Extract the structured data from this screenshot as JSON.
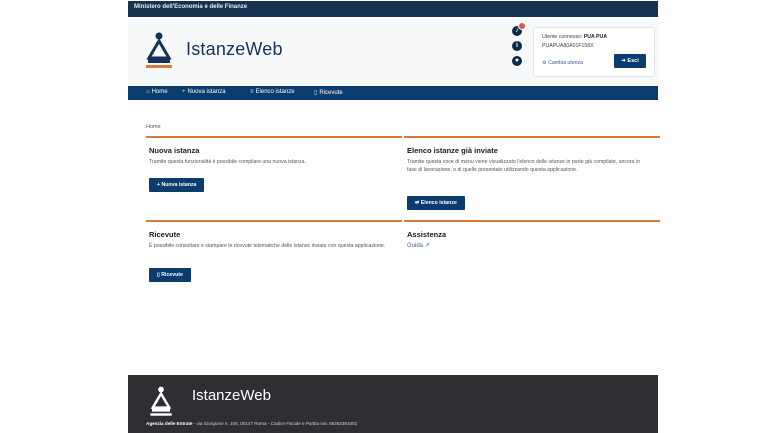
{
  "topbar": {
    "org": "Ministero dell'Economia e delle Finanze"
  },
  "header": {
    "app_title": "IstanzeWeb",
    "icons": [
      "bell-icon",
      "info-icon",
      "user-icon"
    ],
    "user": {
      "line1_label": "Utente connesso:",
      "line1_value": "PUA PUA",
      "line2": "PUAPUA80A01F158X",
      "switch_link": "Cambia utenza",
      "exit_label": "Esci"
    }
  },
  "nav": {
    "items": [
      {
        "icon": "⌂",
        "label": "Home"
      },
      {
        "icon": "+",
        "label": "Nuova istanza"
      },
      {
        "icon": "≡",
        "label": "Elenco istanze"
      },
      {
        "icon": "▯",
        "label": "Ricevute"
      }
    ]
  },
  "breadcrumb": "Home",
  "cards": {
    "new": {
      "title": "Nuova istanza",
      "text": "Tramite questa funzionalità è possibile compilare una nuova istanza.",
      "button": "+ Nuova istanza"
    },
    "list": {
      "title": "Elenco istanze già inviate",
      "text": "Tramite questa voce di menu viene visualizzato l'elenco delle istanze in parte già compilate, ancora in fase di lavorazione, o di quelle presentate utilizzando questa applicazione.",
      "button": "⇄ Elenco istanze"
    },
    "receipts": {
      "title": "Ricevute",
      "text": "È possibile consultare e stampare le ricevute telematiche delle istanze inviate con questa applicazione.",
      "button": "▯ Ricevute"
    },
    "help": {
      "title": "Assistenza",
      "link": "Guida ↗"
    }
  },
  "footer": {
    "title": "IstanzeWeb",
    "agency": "Agenzia delle Entrate",
    "address": " - via Giorgione n. 106, 00147 Roma - Codice Fiscale e Partita Iva: 06363391001"
  },
  "colors": {
    "primary": "#0b3c6e",
    "accent": "#d97a3a",
    "dark": "#16324f",
    "footer": "#2d2f33"
  }
}
